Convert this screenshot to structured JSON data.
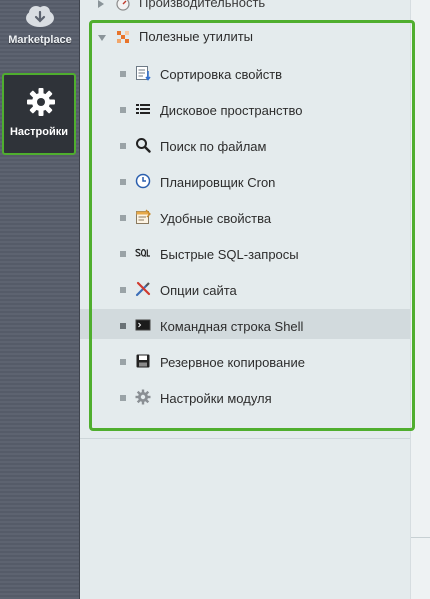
{
  "sidebar": {
    "marketplace_label": "Marketplace",
    "settings_label": "Настройки"
  },
  "tree": {
    "top_item_label": "Производительность",
    "group_label": "Полезные утилиты",
    "items": [
      {
        "label": "Сортировка свойств",
        "icon": "sort-properties-icon"
      },
      {
        "label": "Дисковое пространство",
        "icon": "disk-space-icon"
      },
      {
        "label": "Поиск по файлам",
        "icon": "file-search-icon"
      },
      {
        "label": "Планировщик Cron",
        "icon": "cron-clock-icon"
      },
      {
        "label": "Удобные свойства",
        "icon": "properties-icon"
      },
      {
        "label": "Быстрые SQL-запросы",
        "icon": "sql-icon"
      },
      {
        "label": "Опции сайта",
        "icon": "site-options-icon"
      },
      {
        "label": "Командная строка Shell",
        "icon": "shell-icon"
      },
      {
        "label": "Резервное копирование",
        "icon": "backup-icon"
      },
      {
        "label": "Настройки модуля",
        "icon": "module-settings-icon"
      }
    ],
    "active_item": "Командная строка Shell"
  },
  "colors": {
    "highlight_border": "#4fae2e",
    "sidebar_bg": "#5d6370",
    "panel_bg": "#e4ebed"
  }
}
